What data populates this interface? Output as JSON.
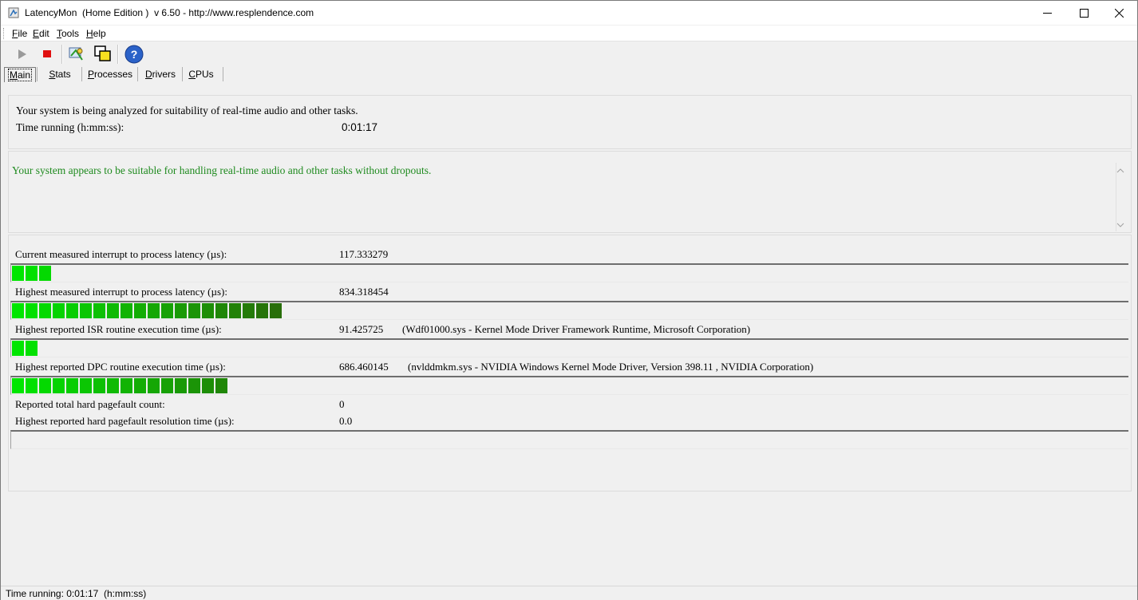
{
  "window": {
    "title": "LatencyMon  (Home Edition )  v 6.50 - http://www.resplendence.com"
  },
  "menu": {
    "items": [
      {
        "label": "File",
        "ul": "F",
        "rest": "ile"
      },
      {
        "label": "Edit",
        "ul": "E",
        "rest": "dit"
      },
      {
        "label": "Tools",
        "ul": "T",
        "rest": "ools"
      },
      {
        "label": "Help",
        "ul": "H",
        "rest": "elp"
      }
    ]
  },
  "toolbar": {
    "buttons": [
      "play-icon",
      "stop-icon",
      "analyze-icon",
      "windows-icon",
      "help-icon"
    ]
  },
  "tabs": [
    {
      "label": "Main",
      "ul": "M",
      "rest": "ain",
      "active": true
    },
    {
      "label": "Stats",
      "ul": "S",
      "rest": "tats",
      "active": false
    },
    {
      "label": "Processes",
      "ul": "P",
      "rest": "rocesses",
      "active": false
    },
    {
      "label": "Drivers",
      "ul": "D",
      "rest": "rivers",
      "active": false
    },
    {
      "label": "CPUs",
      "ul": "C",
      "rest": "PUs",
      "active": false
    }
  ],
  "header": {
    "line1": "Your system is being analyzed for suitability of real-time audio and other tasks.",
    "time_label": "Time running (h:mm:ss):",
    "time_value": "0:01:17"
  },
  "verdict": {
    "text": "Your system appears to be suitable for handling real-time audio and other tasks without dropouts.",
    "color": "#1e8a1e"
  },
  "metrics": {
    "current_latency": {
      "label": "Current measured interrupt to process latency (µs):",
      "value": "117.333279",
      "segments": 3
    },
    "highest_latency": {
      "label": "Highest measured interrupt to process latency (µs):",
      "value": "834.318454",
      "segments": 20
    },
    "isr": {
      "label": "Highest reported ISR routine execution time (µs):",
      "value": "91.425725",
      "detail": "(Wdf01000.sys - Kernel Mode Driver Framework Runtime, Microsoft Corporation)",
      "segments": 2
    },
    "dpc": {
      "label": "Highest reported DPC routine execution time (µs):",
      "value": "686.460145",
      "detail": "(nvlddmkm.sys - NVIDIA Windows Kernel Mode Driver, Version 398.11 , NVIDIA Corporation)",
      "segments": 16
    },
    "pagefault_count": {
      "label": "Reported total hard pagefault count:",
      "value": "0"
    },
    "pagefault_time": {
      "label": "Highest reported hard pagefault resolution time (µs):",
      "value": "0.0",
      "segments": 0
    }
  },
  "status_bar": {
    "text": "Time running: 0:01:17  (h:mm:ss)"
  }
}
